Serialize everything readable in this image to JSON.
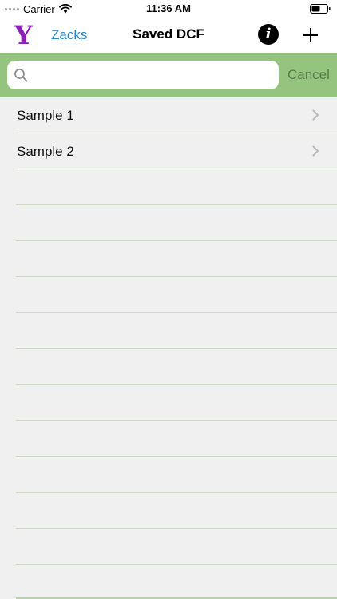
{
  "status_bar": {
    "carrier": "Carrier",
    "time": "11:36 AM"
  },
  "nav": {
    "logo_text": "Y",
    "back_label": "Zacks",
    "title": "Saved DCF",
    "info_label": "i"
  },
  "search": {
    "placeholder": "",
    "value": "",
    "cancel_label": "Cancel"
  },
  "list": {
    "items": [
      {
        "label": "Sample 1"
      },
      {
        "label": "Sample 2"
      }
    ],
    "empty_rows": 11
  },
  "colors": {
    "search_bar_bg": "#95c47e",
    "logo": "#8c1fb8",
    "link": "#2a86c9"
  },
  "icons": [
    "wifi-icon",
    "battery-icon",
    "info-icon",
    "plus-icon",
    "search-icon",
    "chevron-right-icon"
  ]
}
